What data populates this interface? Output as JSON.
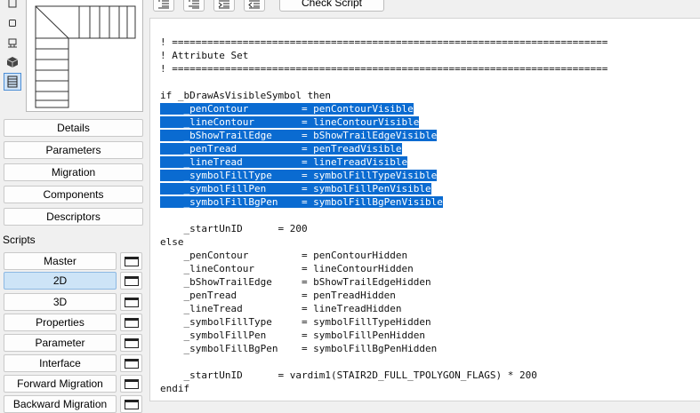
{
  "view_icons": [
    {
      "name": "floor-plan-icon",
      "active": false
    },
    {
      "name": "section-icon",
      "active": false
    },
    {
      "name": "elevation-icon",
      "active": false
    },
    {
      "name": "3d-view-icon",
      "active": false
    },
    {
      "name": "stair-preview-icon",
      "active": true
    }
  ],
  "nav_buttons": [
    "Details",
    "Parameters",
    "Migration",
    "Components",
    "Descriptors"
  ],
  "scripts_label": "Scripts",
  "script_buttons": [
    {
      "label": "Master",
      "selected": false
    },
    {
      "label": "2D",
      "selected": true
    },
    {
      "label": "3D",
      "selected": false
    },
    {
      "label": "Properties",
      "selected": false
    },
    {
      "label": "Parameter",
      "selected": false
    },
    {
      "label": "Interface",
      "selected": false
    },
    {
      "label": "Forward Migration",
      "selected": false
    },
    {
      "label": "Backward Migration",
      "selected": false
    }
  ],
  "toolbar": {
    "check_script_label": "Check Script",
    "icon_buttons": [
      "indent-list-icon",
      "outdent-list-icon",
      "indent-right-icon",
      "indent-left-icon"
    ]
  },
  "code_lines": [
    {
      "text": "! ==========================================================================",
      "highlight": false
    },
    {
      "text": "! Attribute Set",
      "highlight": false
    },
    {
      "text": "! ==========================================================================",
      "highlight": false
    },
    {
      "text": "",
      "highlight": false
    },
    {
      "text": "if _bDrawAsVisibleSymbol then",
      "highlight": false
    },
    {
      "text": "    _penContour         = penContourVisible",
      "highlight": true
    },
    {
      "text": "    _lineContour        = lineContourVisible",
      "highlight": true
    },
    {
      "text": "    _bShowTrailEdge     = bShowTrailEdgeVisible",
      "highlight": true
    },
    {
      "text": "    _penTread           = penTreadVisible",
      "highlight": true
    },
    {
      "text": "    _lineTread          = lineTreadVisible",
      "highlight": true
    },
    {
      "text": "    _symbolFillType     = symbolFillTypeVisible",
      "highlight": true
    },
    {
      "text": "    _symbolFillPen      = symbolFillPenVisible",
      "highlight": true
    },
    {
      "text": "    _symbolFillBgPen    = symbolFillBgPenVisible",
      "highlight": true
    },
    {
      "text": "",
      "highlight": false
    },
    {
      "text": "    _startUnID      = 200",
      "highlight": false
    },
    {
      "text": "else",
      "highlight": false
    },
    {
      "text": "    _penContour         = penContourHidden",
      "highlight": false
    },
    {
      "text": "    _lineContour        = lineContourHidden",
      "highlight": false
    },
    {
      "text": "    _bShowTrailEdge     = bShowTrailEdgeHidden",
      "highlight": false
    },
    {
      "text": "    _penTread           = penTreadHidden",
      "highlight": false
    },
    {
      "text": "    _lineTread          = lineTreadHidden",
      "highlight": false
    },
    {
      "text": "    _symbolFillType     = symbolFillTypeHidden",
      "highlight": false
    },
    {
      "text": "    _symbolFillPen      = symbolFillPenHidden",
      "highlight": false
    },
    {
      "text": "    _symbolFillBgPen    = symbolFillBgPenHidden",
      "highlight": false
    },
    {
      "text": "",
      "highlight": false
    },
    {
      "text": "    _startUnID      = vardim1(STAIR2D_FULL_TPOLYGON_FLAGS) * 200",
      "highlight": false
    },
    {
      "text": "endif",
      "highlight": false
    }
  ],
  "colors": {
    "selection": "#0a6bd1",
    "selected_button": "#cde4f7",
    "panel_background": "#f0f0f0"
  }
}
